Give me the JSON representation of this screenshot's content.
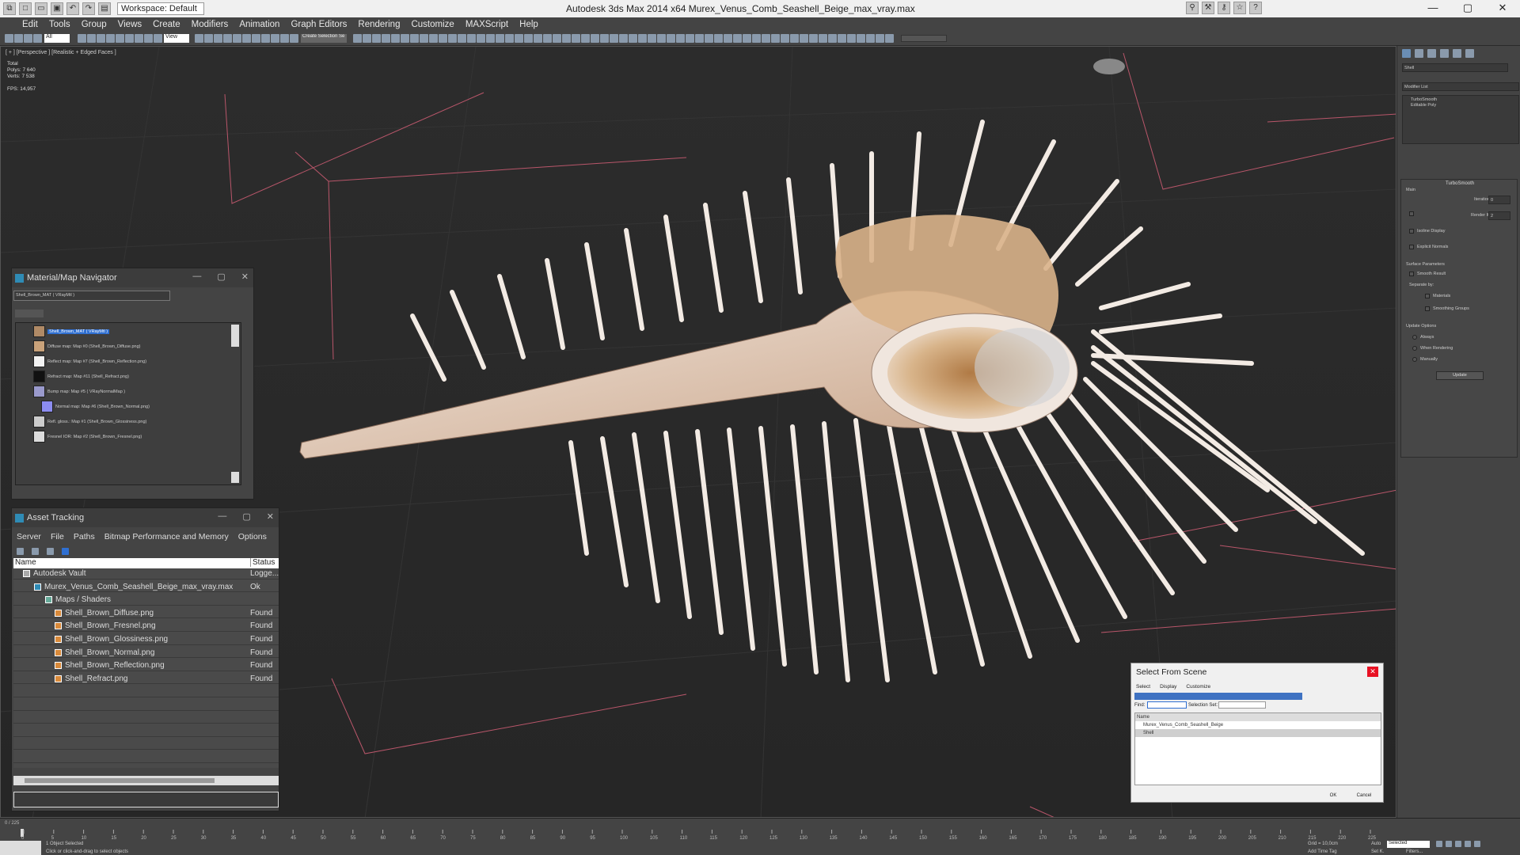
{
  "app": {
    "title": "Autodesk 3ds Max  2014 x64     Murex_Venus_Comb_Seashell_Beige_max_vray.max",
    "workspace_label": "Workspace: Default"
  },
  "menu": [
    "Edit",
    "Tools",
    "Group",
    "Views",
    "Create",
    "Modifiers",
    "Animation",
    "Graph Editors",
    "Rendering",
    "Customize",
    "MAXScript",
    "Help"
  ],
  "toolbar": {
    "selection_filter": "All",
    "ref_coord": "View",
    "named_selection": "Create Selection Se"
  },
  "viewport": {
    "label": "[ + ] [Perspective ] [Realistic + Edged Faces ]",
    "stats": {
      "total_label": "Total",
      "polys_label": "Polys:",
      "polys": "7 640",
      "verts_label": "Verts:",
      "verts": "7 538",
      "fps_label": "FPS:",
      "fps": "14,957"
    }
  },
  "command_panel": {
    "object_name": "Shell",
    "modifier_list": "Modifier List",
    "stack": [
      "TurboSmooth",
      "Editable Poly"
    ],
    "turbosmooth_title": "TurboSmooth",
    "main_label": "Main",
    "iterations_label": "Iterations:",
    "iterations": "0",
    "render_iters_label": "Render Iters:",
    "render_iters": "2",
    "isoline_label": "Isoline Display",
    "explicit_normals_label": "Explicit Normals",
    "surface_params_label": "Surface Parameters",
    "smooth_result_label": "Smooth Result",
    "separate_by_label": "Separate by:",
    "materials_label": "Materials",
    "smoothing_groups_label": "Smoothing Groups",
    "update_options_label": "Update Options",
    "always_label": "Always",
    "when_rendering_label": "When Rendering",
    "manually_label": "Manually",
    "update_button": "Update"
  },
  "material_navigator": {
    "title": "Material/Map Navigator",
    "field": "Shell_Brown_MAT  ( VRayMtl )",
    "items": [
      {
        "label": "Shell_Brown_MAT  ( VRayMtl )",
        "selected": true,
        "thumb": "#b08a66"
      },
      {
        "label": "Diffuse map: Map #0 (Shell_Brown_Diffuse.png)",
        "thumb": "#c9a27a"
      },
      {
        "label": "Reflect map: Map #7 (Shell_Brown_Reflection.png)",
        "thumb": "#f2f2f2"
      },
      {
        "label": "Refract map: Map #11 (Shell_Refract.png)",
        "thumb": "#111111"
      },
      {
        "label": "Bump map: Map #5  ( VRayNormalMap )",
        "thumb": "#9a9acc"
      },
      {
        "label": "Normal map: Map #6 (Shell_Brown_Normal.png)",
        "thumb": "#8c8cf0"
      },
      {
        "label": "Refl. gloss.: Map #1 (Shell_Brown_Glossiness.png)",
        "thumb": "#cccccc"
      },
      {
        "label": "Fresnel IOR: Map #2 (Shell_Brown_Fresnel.png)",
        "thumb": "#dddddd"
      }
    ]
  },
  "asset_tracking": {
    "title": "Asset Tracking",
    "menu": [
      "Server",
      "File",
      "Paths",
      "Bitmap Performance and Memory",
      "Options"
    ],
    "col_name": "Name",
    "col_status": "Status",
    "rows": [
      {
        "name": "Autodesk Vault",
        "status": "Logge...",
        "level": 0,
        "icon": "vault-icon"
      },
      {
        "name": "Murex_Venus_Comb_Seashell_Beige_max_vray.max",
        "status": "Ok",
        "level": 1,
        "icon": "max-file-icon"
      },
      {
        "name": "Maps / Shaders",
        "status": "",
        "level": 2,
        "icon": "folder-icon"
      },
      {
        "name": "Shell_Brown_Diffuse.png",
        "status": "Found",
        "level": 3,
        "icon": "bitmap-icon"
      },
      {
        "name": "Shell_Brown_Fresnel.png",
        "status": "Found",
        "level": 3,
        "icon": "bitmap-icon"
      },
      {
        "name": "Shell_Brown_Glossiness.png",
        "status": "Found",
        "level": 3,
        "icon": "bitmap-icon"
      },
      {
        "name": "Shell_Brown_Normal.png",
        "status": "Found",
        "level": 3,
        "icon": "bitmap-icon"
      },
      {
        "name": "Shell_Brown_Reflection.png",
        "status": "Found",
        "level": 3,
        "icon": "bitmap-icon"
      },
      {
        "name": "Shell_Refract.png",
        "status": "Found",
        "level": 3,
        "icon": "bitmap-icon"
      }
    ]
  },
  "select_from_scene": {
    "title": "Select From Scene",
    "menu": [
      "Select",
      "Display",
      "Customize"
    ],
    "find_label": "Find:",
    "selection_set_label": "Selection Set:",
    "col_name": "Name",
    "items": [
      "Murex_Venus_Comb_Seashell_Beige",
      "Shell"
    ],
    "ok": "OK",
    "cancel": "Cancel"
  },
  "timeline": {
    "frame": "0 / 225",
    "ticks": [
      "0",
      "5",
      "10",
      "15",
      "20",
      "25",
      "30",
      "35",
      "40",
      "45",
      "50",
      "55",
      "60",
      "65",
      "70",
      "75",
      "80",
      "85",
      "90",
      "95",
      "100",
      "105",
      "110",
      "115",
      "120",
      "125",
      "130",
      "135",
      "140",
      "145",
      "150",
      "155",
      "160",
      "165",
      "170",
      "175",
      "180",
      "185",
      "190",
      "195",
      "200",
      "205",
      "210",
      "215",
      "220",
      "225"
    ],
    "status1": "1 Object Selected",
    "status2": "Click or click-and-drag to select objects",
    "grid": "Grid = 10,0cm",
    "add_time_tag": "Add Time Tag",
    "auto": "Auto",
    "set_key": "Set K.",
    "selected": "Selected",
    "filters": "Filters..."
  },
  "colors": {
    "accent": "#2f8bb5",
    "panel": "#444444",
    "viewport": "#2b2b2b",
    "shell": "#e8d8cc",
    "grid_lines": "#c05a6a"
  }
}
